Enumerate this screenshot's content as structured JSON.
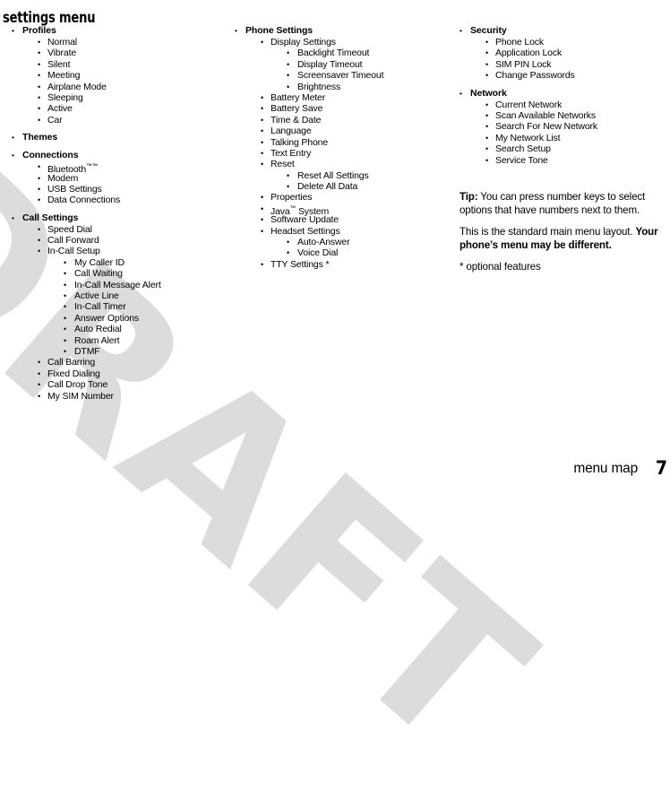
{
  "page": {
    "title": "settings menu",
    "bullet_glyph": "•",
    "watermark_text": "DRAFT",
    "watermark_color": "#dcdcdc",
    "text_color": "#000000",
    "background_color": "#ffffff"
  },
  "footer": {
    "label": "menu map",
    "page_number": "7"
  },
  "columns": [
    {
      "id": "column-1",
      "rows": [
        {
          "level": 1,
          "text": "Profiles"
        },
        {
          "level": 2,
          "text": "Normal"
        },
        {
          "level": 2,
          "text": "Vibrate"
        },
        {
          "level": 2,
          "text": "Silent"
        },
        {
          "level": 2,
          "text": "Meeting"
        },
        {
          "level": 2,
          "text": "Airplane Mode"
        },
        {
          "level": 2,
          "text": "Sleeping"
        },
        {
          "level": 2,
          "text": "Active"
        },
        {
          "level": 2,
          "text": "Car"
        },
        {
          "level": 0,
          "text": ""
        },
        {
          "level": 1,
          "text": "Themes"
        },
        {
          "level": 0,
          "text": ""
        },
        {
          "level": 1,
          "text": "Connections"
        },
        {
          "level": 2,
          "text": "Bluetooth",
          "sup": "™™"
        },
        {
          "level": 2,
          "text": "Modem"
        },
        {
          "level": 2,
          "text": "USB Settings"
        },
        {
          "level": 2,
          "text": "Data Connections"
        },
        {
          "level": 0,
          "text": ""
        },
        {
          "level": 1,
          "text": "Call Settings"
        },
        {
          "level": 2,
          "text": "Speed Dial"
        },
        {
          "level": 2,
          "text": "Call Forward"
        },
        {
          "level": 2,
          "text": "In-Call Setup"
        },
        {
          "level": 3,
          "text": "My Caller ID"
        },
        {
          "level": 3,
          "text": "Call Waiting"
        },
        {
          "level": 3,
          "text": "In-Call Message Alert"
        },
        {
          "level": 3,
          "text": "Active Line"
        },
        {
          "level": 3,
          "text": "In-Call Timer"
        },
        {
          "level": 3,
          "text": "Answer Options"
        },
        {
          "level": 3,
          "text": "Auto Redial"
        },
        {
          "level": 3,
          "text": "Roam Alert"
        },
        {
          "level": 3,
          "text": "DTMF"
        },
        {
          "level": 2,
          "text": "Call Barring"
        },
        {
          "level": 2,
          "text": "Fixed Dialing"
        },
        {
          "level": 2,
          "text": "Call Drop Tone"
        },
        {
          "level": 2,
          "text": "My SIM Number"
        }
      ]
    },
    {
      "id": "column-2",
      "rows": [
        {
          "level": 1,
          "text": "Phone Settings"
        },
        {
          "level": 2,
          "text": "Display Settings"
        },
        {
          "level": 3,
          "text": "Backlight Timeout"
        },
        {
          "level": 3,
          "text": "Display Timeout"
        },
        {
          "level": 3,
          "text": "Screensaver Timeout"
        },
        {
          "level": 3,
          "text": "Brightness"
        },
        {
          "level": 2,
          "text": "Battery Meter"
        },
        {
          "level": 2,
          "text": "Battery Save"
        },
        {
          "level": 2,
          "text": "Time & Date"
        },
        {
          "level": 2,
          "text": "Language"
        },
        {
          "level": 2,
          "text": "Talking Phone"
        },
        {
          "level": 2,
          "text": "Text Entry"
        },
        {
          "level": 2,
          "text": "Reset"
        },
        {
          "level": 3,
          "text": "Reset All Settings"
        },
        {
          "level": 3,
          "text": "Delete All Data"
        },
        {
          "level": 2,
          "text": "Properties"
        },
        {
          "level": 2,
          "text": "Java",
          "sup": "™",
          "suffix": " System"
        },
        {
          "level": 2,
          "text": "Software Update"
        },
        {
          "level": 2,
          "text": "Headset Settings"
        },
        {
          "level": 3,
          "text": "Auto-Answer"
        },
        {
          "level": 3,
          "text": "Voice Dial"
        },
        {
          "level": 2,
          "text": "TTY Settings *"
        }
      ]
    },
    {
      "id": "column-3",
      "rows": [
        {
          "level": 1,
          "text": "Security"
        },
        {
          "level": 2,
          "text": "Phone Lock"
        },
        {
          "level": 2,
          "text": "Application Lock"
        },
        {
          "level": 2,
          "text": "SIM PIN Lock"
        },
        {
          "level": 2,
          "text": "Change Passwords"
        },
        {
          "level": 0,
          "text": ""
        },
        {
          "level": 1,
          "text": "Network"
        },
        {
          "level": 2,
          "text": "Current Network"
        },
        {
          "level": 2,
          "text": "Scan Available Networks"
        },
        {
          "level": 2,
          "text": "Search For New Network"
        },
        {
          "level": 2,
          "text": "My Network List"
        },
        {
          "level": 2,
          "text": "Search Setup"
        },
        {
          "level": 2,
          "text": "Service Tone"
        }
      ]
    }
  ],
  "tip": {
    "label": "Tip:",
    "body": " You can press number keys to select options that have numbers next to them.",
    "note_plain": "This is the standard main menu layout. ",
    "note_bold": "Your phone’s menu may be different.",
    "footnote": "* optional features"
  }
}
